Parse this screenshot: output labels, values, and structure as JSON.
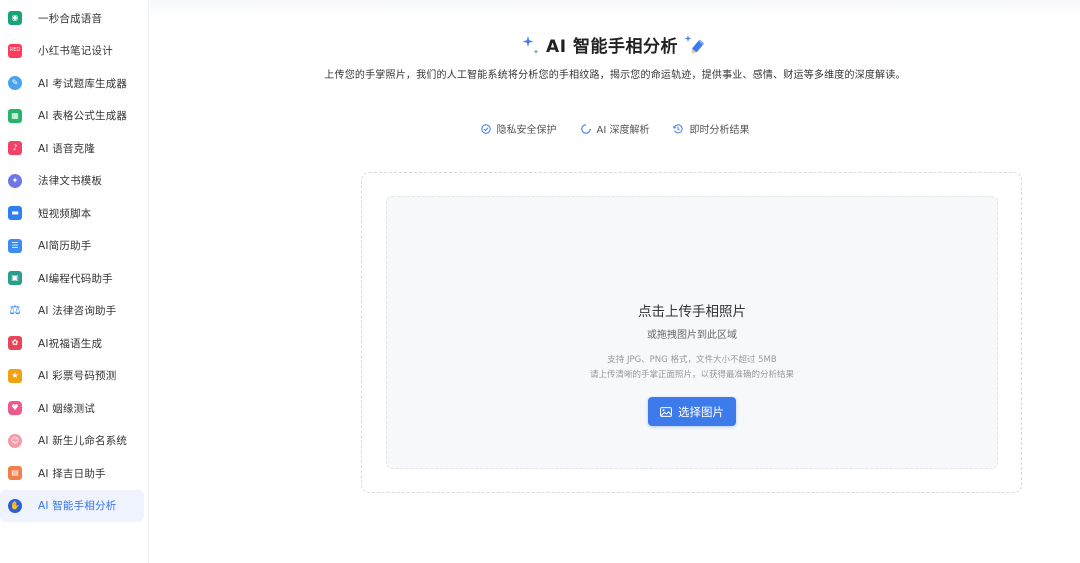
{
  "sidebar": {
    "items": [
      {
        "label": "一秒合成语音",
        "icon": "voice-synth-icon",
        "color": "#1aa37a"
      },
      {
        "label": "小红书笔记设计",
        "icon": "xiaohongshu-icon",
        "color": "#ff3b5c"
      },
      {
        "label": "AI 考试题库生成器",
        "icon": "exam-icon",
        "color": "#4aa3f0"
      },
      {
        "label": "AI 表格公式生成器",
        "icon": "spreadsheet-icon",
        "color": "#27b36a"
      },
      {
        "label": "AI 语音克隆",
        "icon": "voice-clone-icon",
        "color": "#f0436a"
      },
      {
        "label": "法律文书模板",
        "icon": "legal-doc-icon",
        "color": "#6f77e8"
      },
      {
        "label": "短视频脚本",
        "icon": "video-script-icon",
        "color": "#2f7ff0"
      },
      {
        "label": "AI简历助手",
        "icon": "resume-icon",
        "color": "#3b8df2"
      },
      {
        "label": "AI编程代码助手",
        "icon": "code-icon",
        "color": "#2a9d8f"
      },
      {
        "label": "AI 法律咨询助手",
        "icon": "scales-icon",
        "color": "#3a86e8"
      },
      {
        "label": "AI祝福语生成",
        "icon": "blessing-icon",
        "color": "#e8445a"
      },
      {
        "label": "AI 彩票号码预测",
        "icon": "lottery-icon",
        "color": "#f2a115"
      },
      {
        "label": "AI 姻缘测试",
        "icon": "marriage-icon",
        "color": "#f05a8a"
      },
      {
        "label": "AI 新生儿命名系统",
        "icon": "baby-icon",
        "color": "#f29aa8"
      },
      {
        "label": "AI 择吉日助手",
        "icon": "calendar-icon",
        "color": "#f07f4a"
      },
      {
        "label": "AI 智能手相分析",
        "icon": "palm-icon",
        "color": "#2e5fd6",
        "active": true
      }
    ]
  },
  "header": {
    "title": "AI 智能手相分析",
    "subtitle": "上传您的手掌照片，我们的人工智能系统将分析您的手相纹路，揭示您的命运轨迹，提供事业、感情、财运等多维度的深度解读。"
  },
  "features": [
    {
      "label": "隐私安全保护",
      "icon": "shield-check-icon"
    },
    {
      "label": "AI 深度解析",
      "icon": "spinner-icon"
    },
    {
      "label": "即时分析结果",
      "icon": "clock-refresh-icon"
    }
  ],
  "upload": {
    "title": "点击上传手相照片",
    "subtitle": "或拖拽图片到此区域",
    "note1": "支持 JPG、PNG 格式，文件大小不超过 5MB",
    "note2": "请上传清晰的手掌正面照片，以获得最准确的分析结果",
    "button_label": "选择图片"
  },
  "colors": {
    "accent": "#3d7bea",
    "active_bg": "#eef3fd"
  }
}
